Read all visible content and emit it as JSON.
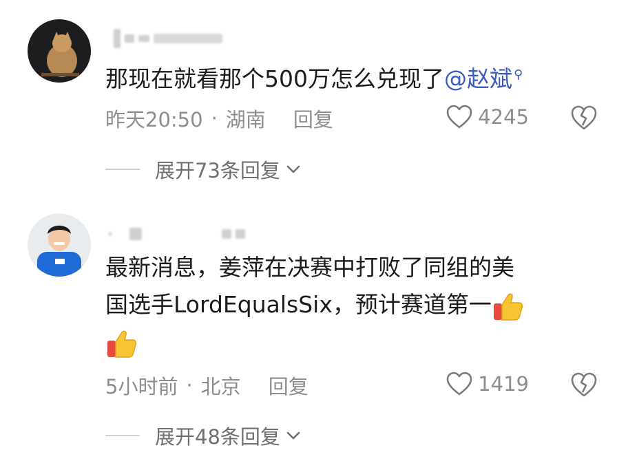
{
  "comments": [
    {
      "text_before_mention": "那现在就看那个500万怎么兑现了",
      "mention": "@赵斌",
      "search_icon": "search-icon",
      "time": "昨天20:50",
      "dot": "·",
      "location": "湖南",
      "reply_label": "回复",
      "likes": "4245",
      "expand_label": "展开73条回复"
    },
    {
      "line1": "最新消息，姜萍在决赛中打败了同组的美",
      "line2": "国选手LordEqualsSix，预计赛道第一",
      "emoji": "thumbs-up-icon",
      "time": "5小时前",
      "dot": "·",
      "location": "北京",
      "reply_label": "回复",
      "likes": "1419",
      "expand_label": "展开48条回复"
    }
  ],
  "colors": {
    "mention": "#3b5bbf",
    "meta": "#8d8d8d",
    "text": "#1c1c1c"
  }
}
